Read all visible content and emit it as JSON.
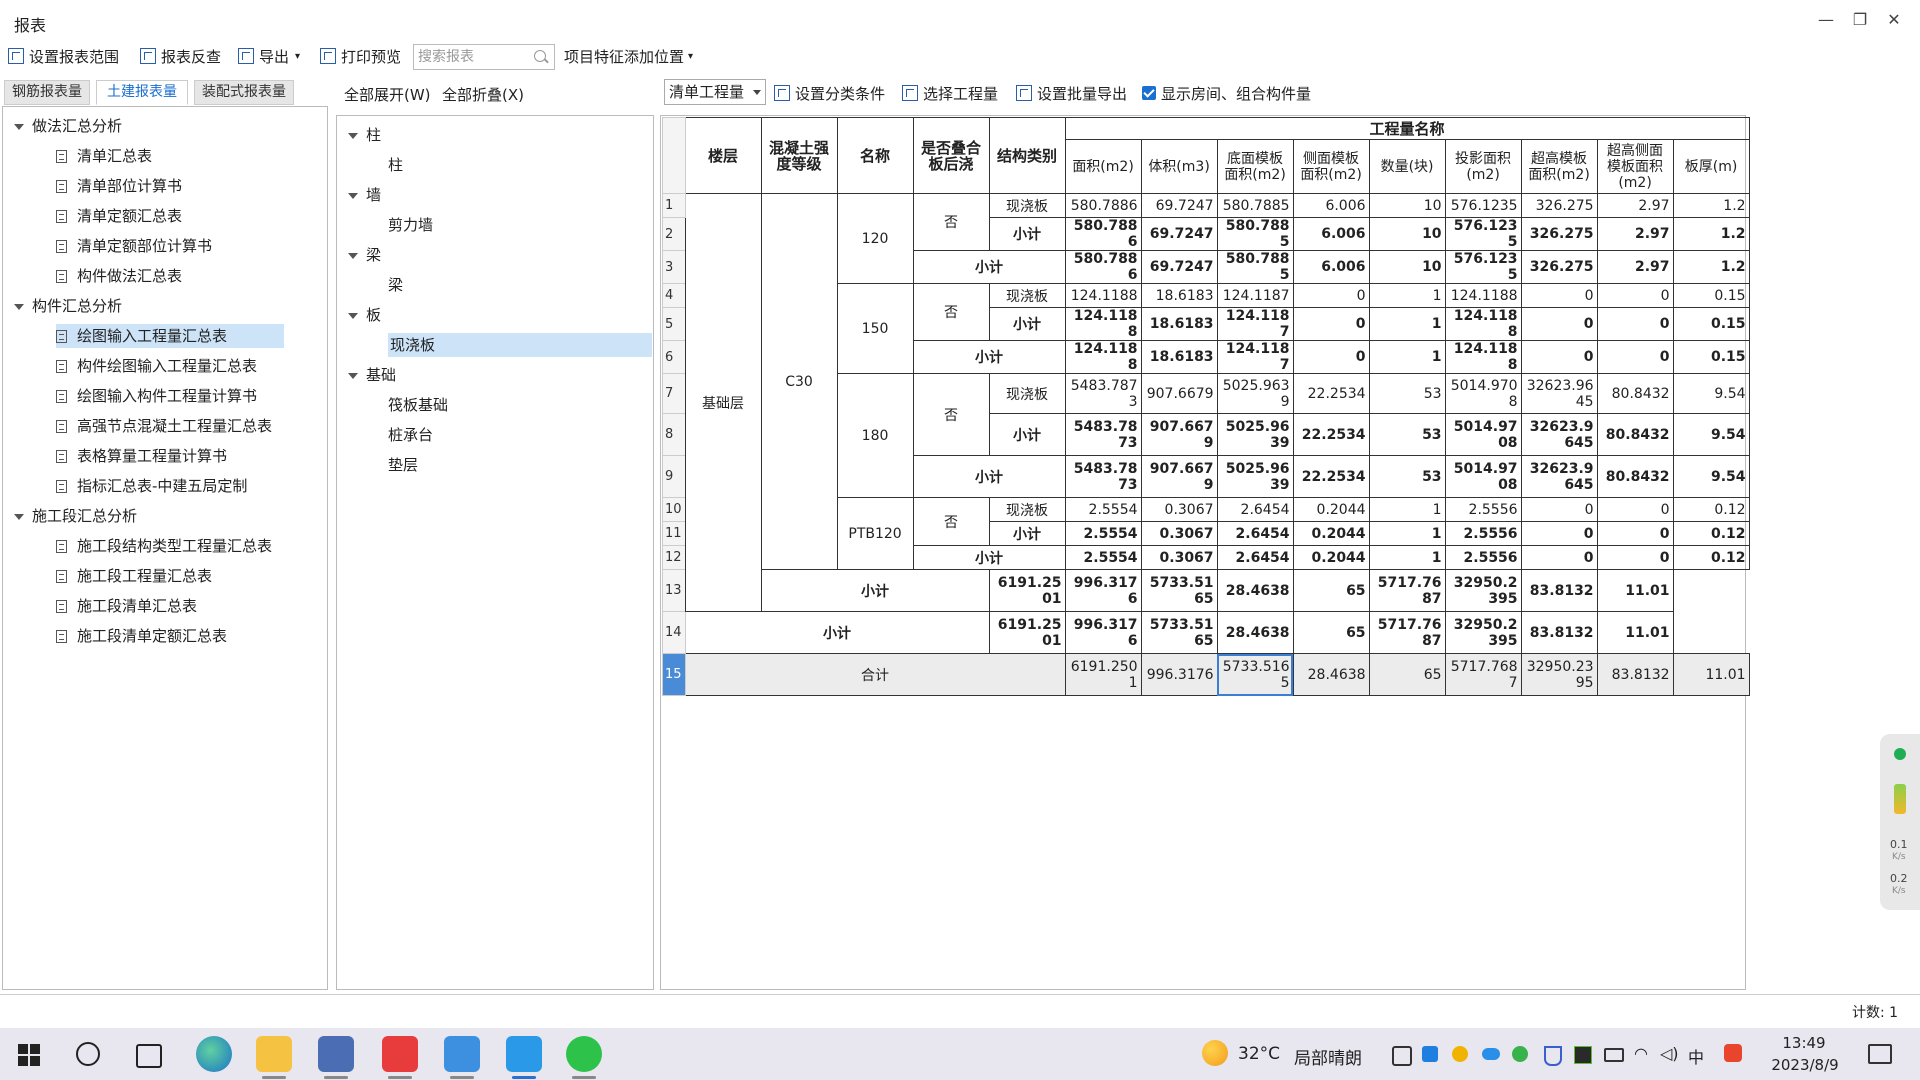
{
  "window": {
    "title": "报表",
    "minimize": "—",
    "restore": "❐",
    "close": "✕"
  },
  "toolbar": {
    "items": [
      "设置报表范围",
      "报表反查",
      "导出",
      "打印预览"
    ],
    "search_placeholder": "搜索报表",
    "add_position": "项目特征添加位置"
  },
  "left_tabs": [
    "钢筋报表量",
    "土建报表量",
    "装配式报表量"
  ],
  "left_tree": [
    {
      "type": "group",
      "label": "做法汇总分析"
    },
    {
      "type": "leaf",
      "label": "清单汇总表"
    },
    {
      "type": "leaf",
      "label": "清单部位计算书"
    },
    {
      "type": "leaf",
      "label": "清单定额汇总表"
    },
    {
      "type": "leaf",
      "label": "清单定额部位计算书"
    },
    {
      "type": "leaf",
      "label": "构件做法汇总表"
    },
    {
      "type": "group",
      "label": "构件汇总分析"
    },
    {
      "type": "leaf",
      "label": "绘图输入工程量汇总表",
      "selected": true
    },
    {
      "type": "leaf",
      "label": "构件绘图输入工程量汇总表"
    },
    {
      "type": "leaf",
      "label": "绘图输入构件工程量计算书"
    },
    {
      "type": "leaf",
      "label": "高强节点混凝土工程量汇总表"
    },
    {
      "type": "leaf",
      "label": "表格算量工程量计算书"
    },
    {
      "type": "leaf",
      "label": "指标汇总表-中建五局定制"
    },
    {
      "type": "group",
      "label": "施工段汇总分析"
    },
    {
      "type": "leaf",
      "label": "施工段结构类型工程量汇总表"
    },
    {
      "type": "leaf",
      "label": "施工段工程量汇总表"
    },
    {
      "type": "leaf",
      "label": "施工段清单汇总表"
    },
    {
      "type": "leaf",
      "label": "施工段清单定额汇总表"
    }
  ],
  "mid_header": {
    "expand_all": "全部展开(W)",
    "collapse_all": "全部折叠(X)"
  },
  "mid_tree": [
    {
      "type": "group",
      "label": "柱"
    },
    {
      "type": "leaf",
      "label": "柱"
    },
    {
      "type": "group",
      "label": "墙"
    },
    {
      "type": "leaf",
      "label": "剪力墙"
    },
    {
      "type": "group",
      "label": "梁"
    },
    {
      "type": "leaf",
      "label": "梁"
    },
    {
      "type": "group",
      "label": "板"
    },
    {
      "type": "leaf",
      "label": "现浇板",
      "selected": true
    },
    {
      "type": "group",
      "label": "基础"
    },
    {
      "type": "leaf",
      "label": "筏板基础"
    },
    {
      "type": "leaf",
      "label": "桩承台"
    },
    {
      "type": "leaf",
      "label": "垫层"
    }
  ],
  "right_toolbar": {
    "combo": "清单工程量",
    "set_category": "设置分类条件",
    "select_quantity": "选择工程量",
    "batch_export": "设置批量导出",
    "show_rooms": "显示房间、组合构件量"
  },
  "grid": {
    "headers": {
      "floor": "楼层",
      "concrete": "混凝土强度等级",
      "name": "名称",
      "overlap": "是否叠合板后浇",
      "struct": "结构类别",
      "group": "工程量名称",
      "cols": [
        "面积(m2)",
        "体积(m3)",
        "底面模板面积(m2)",
        "侧面模板面积(m2)",
        "数量(块)",
        "投影面积(m2)",
        "超高模板面积(m2)",
        "超高侧面模板面积(m2)",
        "板厚(m)"
      ]
    },
    "floor": "基础层",
    "concrete": "C30",
    "groups": [
      {
        "name": "120",
        "overlap": "否",
        "rows": [
          {
            "rn": "1",
            "label": "现浇板",
            "vals": [
              "580.7886",
              "69.7247",
              "580.7885",
              "6.006",
              "10",
              "576.1235",
              "326.275",
              "2.97",
              "1.2"
            ]
          },
          {
            "rn": "2",
            "label": "小计",
            "vals": [
              "580.7886",
              "69.7247",
              "580.7885",
              "6.006",
              "10",
              "576.1235",
              "326.275",
              "2.97",
              "1.2"
            ]
          },
          {
            "rn": "3",
            "label": "小计",
            "vals": [
              "580.7886",
              "69.7247",
              "580.7885",
              "6.006",
              "10",
              "576.1235",
              "326.275",
              "2.97",
              "1.2"
            ]
          }
        ]
      },
      {
        "name": "150",
        "overlap": "否",
        "rows": [
          {
            "rn": "4",
            "label": "现浇板",
            "vals": [
              "124.1188",
              "18.6183",
              "124.1187",
              "0",
              "1",
              "124.1188",
              "0",
              "0",
              "0.15"
            ]
          },
          {
            "rn": "5",
            "label": "小计",
            "vals": [
              "124.1188",
              "18.6183",
              "124.1187",
              "0",
              "1",
              "124.1188",
              "0",
              "0",
              "0.15"
            ]
          },
          {
            "rn": "6",
            "label": "小计",
            "vals": [
              "124.1188",
              "18.6183",
              "124.1187",
              "0",
              "1",
              "124.1188",
              "0",
              "0",
              "0.15"
            ]
          }
        ]
      },
      {
        "name": "180",
        "overlap": "否",
        "rows": [
          {
            "rn": "7",
            "label": "现浇板",
            "vals": [
              "5483.7873",
              "907.6679",
              "5025.9639",
              "22.2534",
              "53",
              "5014.9708",
              "32623.9645",
              "80.8432",
              "9.54"
            ]
          },
          {
            "rn": "8",
            "label": "小计",
            "vals": [
              "5483.7873",
              "907.6679",
              "5025.9639",
              "22.2534",
              "53",
              "5014.9708",
              "32623.9645",
              "80.8432",
              "9.54"
            ]
          },
          {
            "rn": "9",
            "label": "小计",
            "vals": [
              "5483.7873",
              "907.6679",
              "5025.9639",
              "22.2534",
              "53",
              "5014.9708",
              "32623.9645",
              "80.8432",
              "9.54"
            ]
          }
        ]
      },
      {
        "name": "PTB120",
        "overlap": "否",
        "rows": [
          {
            "rn": "10",
            "label": "现浇板",
            "vals": [
              "2.5554",
              "0.3067",
              "2.6454",
              "0.2044",
              "1",
              "2.5556",
              "0",
              "0",
              "0.12"
            ]
          },
          {
            "rn": "11",
            "label": "小计",
            "vals": [
              "2.5554",
              "0.3067",
              "2.6454",
              "0.2044",
              "1",
              "2.5556",
              "0",
              "0",
              "0.12"
            ]
          },
          {
            "rn": "12",
            "label": "小计",
            "vals": [
              "2.5554",
              "0.3067",
              "2.6454",
              "0.2044",
              "1",
              "2.5556",
              "0",
              "0",
              "0.12"
            ]
          }
        ]
      }
    ],
    "subtotal13": {
      "rn": "13",
      "label": "小计",
      "vals": [
        "6191.2501",
        "996.3176",
        "5733.5165",
        "28.4638",
        "65",
        "5717.7687",
        "32950.2395",
        "83.8132",
        "11.01"
      ]
    },
    "subtotal14": {
      "rn": "14",
      "label": "小计",
      "vals": [
        "6191.2501",
        "996.3176",
        "5733.5165",
        "28.4638",
        "65",
        "5717.7687",
        "32950.2395",
        "83.8132",
        "11.01"
      ]
    },
    "total": {
      "rn": "15",
      "label": "合计",
      "vals": [
        "6191.2501",
        "996.3176",
        "5733.5165",
        "28.4638",
        "65",
        "5717.7687",
        "32950.2395",
        "83.8132",
        "11.01"
      ]
    }
  },
  "status": {
    "count": "计数: 1"
  },
  "widget": {
    "up": "0.1",
    "up_unit": "K/s",
    "down": "0.2",
    "down_unit": "K/s"
  },
  "taskbar": {
    "weather_temp": "32°C",
    "weather_desc": "局部晴朗",
    "ime": "中",
    "time": "13:49",
    "date": "2023/8/9"
  },
  "colors": {
    "accent": "#1a6fd0",
    "selected": "#cde3f8",
    "taskbar": "#e8e6ef"
  }
}
